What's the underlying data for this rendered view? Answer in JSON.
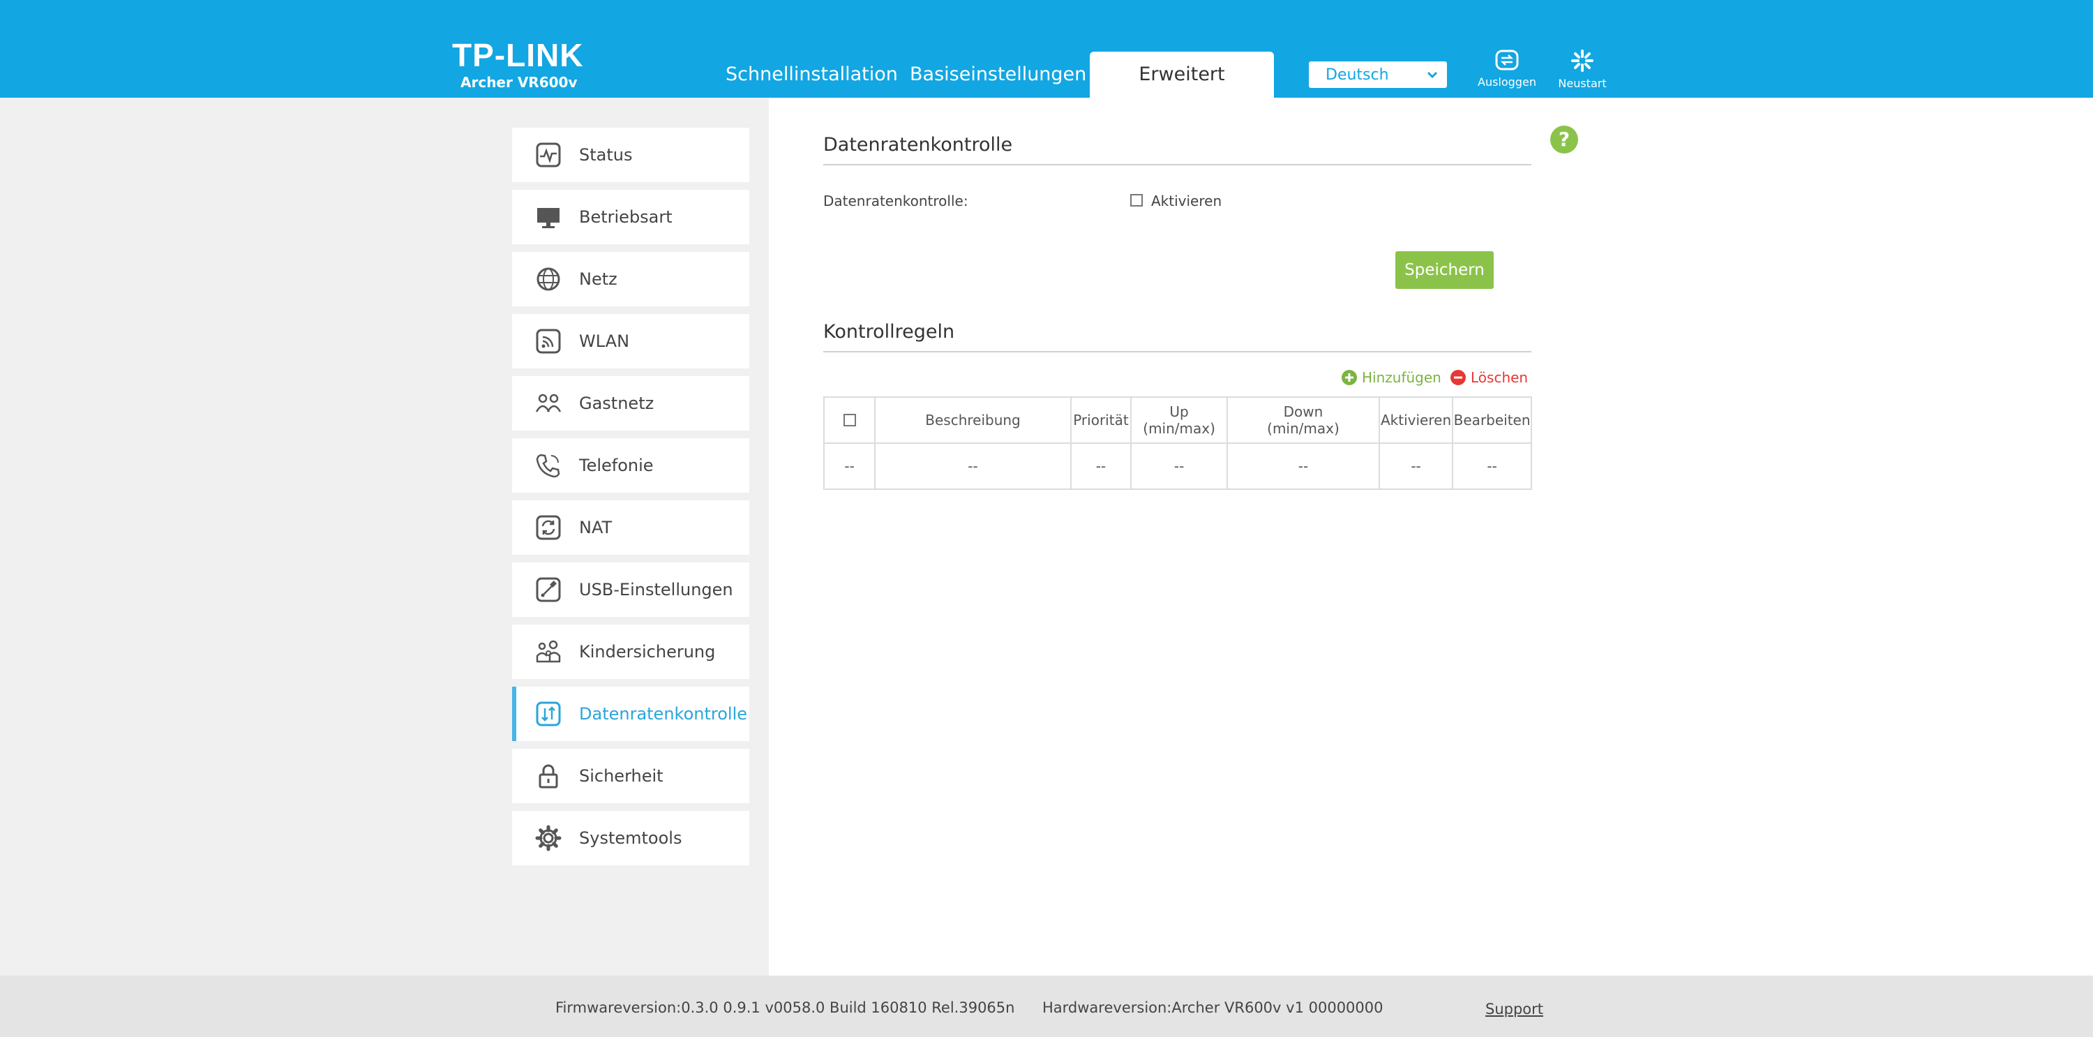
{
  "header": {
    "logo": "TP-LINK",
    "model": "Archer VR600v",
    "tabs": [
      {
        "label": "Schnellinstallation"
      },
      {
        "label": "Basiseinstellungen"
      },
      {
        "label": "Erweitert"
      }
    ],
    "language": "Deutsch",
    "logout_label": "Ausloggen",
    "reboot_label": "Neustart"
  },
  "sidebar": {
    "items": [
      {
        "label": "Status",
        "icon": "pulse-icon"
      },
      {
        "label": "Betriebsart",
        "icon": "monitor-icon"
      },
      {
        "label": "Netz",
        "icon": "globe-icon"
      },
      {
        "label": "WLAN",
        "icon": "wifi-icon"
      },
      {
        "label": "Gastnetz",
        "icon": "guests-icon"
      },
      {
        "label": "Telefonie",
        "icon": "phone-icon"
      },
      {
        "label": "NAT",
        "icon": "refresh-icon"
      },
      {
        "label": "USB-Einstellungen",
        "icon": "usb-icon"
      },
      {
        "label": "Kindersicherung",
        "icon": "family-icon"
      },
      {
        "label": "Datenratenkontrolle",
        "icon": "updown-arrows-icon"
      },
      {
        "label": "Sicherheit",
        "icon": "lock-icon"
      },
      {
        "label": "Systemtools",
        "icon": "gear-icon"
      }
    ],
    "active_index": 9
  },
  "main": {
    "section1_title": "Datenratenkontrolle",
    "field_label": "Datenratenkontrolle:",
    "enable_label": "Aktivieren",
    "save_label": "Speichern",
    "section2_title": "Kontrollregeln",
    "add_label": "Hinzufügen",
    "delete_label": "Löschen",
    "table": {
      "headers": [
        "Beschreibung",
        "Priorität",
        "Up (min/max)",
        "Down (min/max)",
        "Aktivieren",
        "Bearbeiten"
      ],
      "row": [
        "--",
        "--",
        "--",
        "--",
        "--",
        "--",
        "--"
      ]
    },
    "help_symbol": "?"
  },
  "footer": {
    "firmware": "Firmwareversion:0.3.0 0.9.1 v0058.0 Build 160810 Rel.39065n",
    "hardware": "Hardwareversion:Archer VR600v v1 00000000",
    "support": "Support"
  },
  "colors": {
    "header": "#12a6e2",
    "accent_green": "#8bc34a",
    "delete_red": "#e53935",
    "active_blue": "#2aa5dc"
  }
}
